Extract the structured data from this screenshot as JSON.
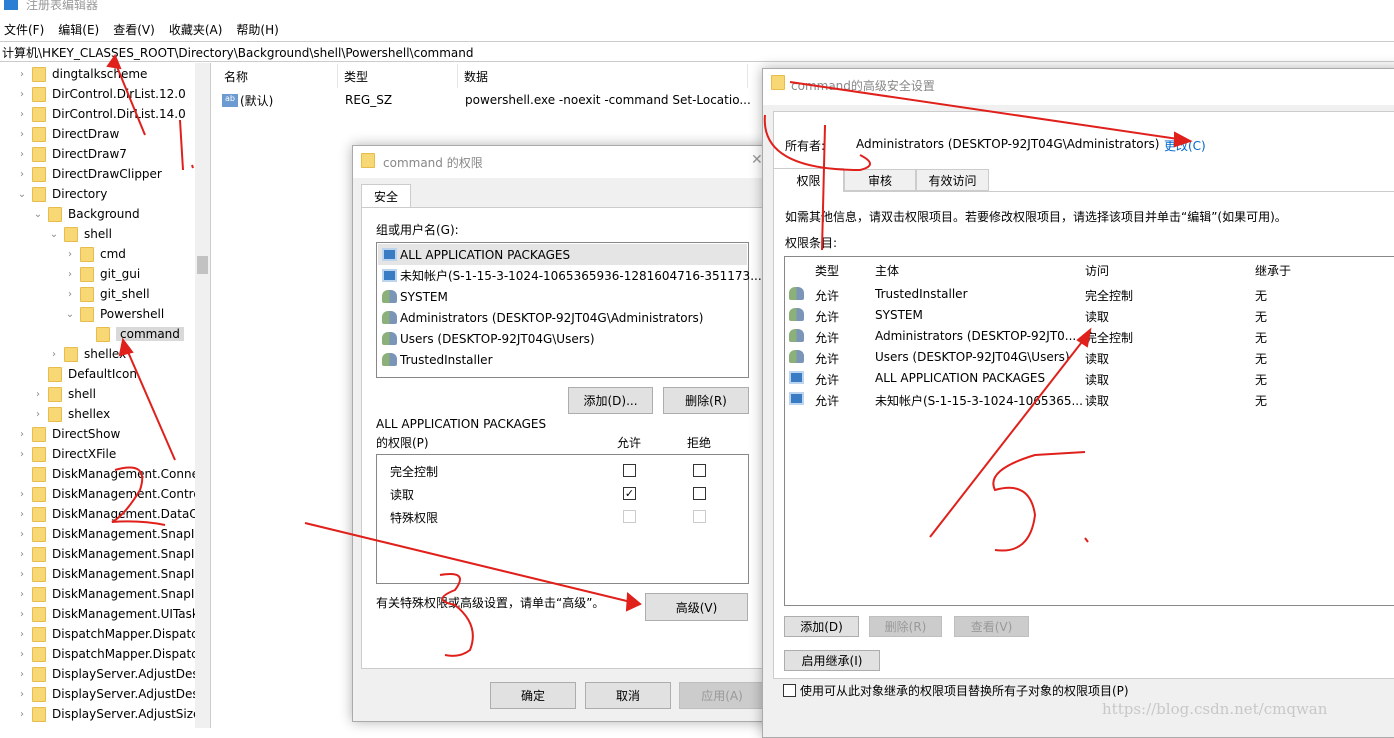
{
  "app": {
    "title": "注册表编辑器"
  },
  "menu": [
    "文件(F)",
    "编辑(E)",
    "查看(V)",
    "收藏夹(A)",
    "帮助(H)"
  ],
  "address": "计算机\\HKEY_CLASSES_ROOT\\Directory\\Background\\shell\\Powershell\\command",
  "tree": [
    {
      "label": "dingtalkscheme",
      "level": 0,
      "exp": ">"
    },
    {
      "label": "DirControl.DirList.12.0",
      "level": 0,
      "exp": ">"
    },
    {
      "label": "DirControl.DirList.14.0",
      "level": 0,
      "exp": ">"
    },
    {
      "label": "DirectDraw",
      "level": 0,
      "exp": ">"
    },
    {
      "label": "DirectDraw7",
      "level": 0,
      "exp": ">"
    },
    {
      "label": "DirectDrawClipper",
      "level": 0,
      "exp": ">"
    },
    {
      "label": "Directory",
      "level": 0,
      "exp": "v"
    },
    {
      "label": "Background",
      "level": 1,
      "exp": "v"
    },
    {
      "label": "shell",
      "level": 2,
      "exp": "v"
    },
    {
      "label": "cmd",
      "level": 3,
      "exp": ">"
    },
    {
      "label": "git_gui",
      "level": 3,
      "exp": ">"
    },
    {
      "label": "git_shell",
      "level": 3,
      "exp": ">"
    },
    {
      "label": "Powershell",
      "level": 3,
      "exp": "v"
    },
    {
      "label": "command",
      "level": 4,
      "exp": "",
      "selected": true
    },
    {
      "label": "shellex",
      "level": 2,
      "exp": ">"
    },
    {
      "label": "DefaultIcon",
      "level": 1,
      "exp": ""
    },
    {
      "label": "shell",
      "level": 1,
      "exp": ">"
    },
    {
      "label": "shellex",
      "level": 1,
      "exp": ">"
    },
    {
      "label": "DirectShow",
      "level": 0,
      "exp": ">"
    },
    {
      "label": "DirectXFile",
      "level": 0,
      "exp": ">"
    },
    {
      "label": "DiskManagement.Conne",
      "level": 0,
      "exp": ""
    },
    {
      "label": "DiskManagement.Contro",
      "level": 0,
      "exp": ">"
    },
    {
      "label": "DiskManagement.DataO",
      "level": 0,
      "exp": ">"
    },
    {
      "label": "DiskManagement.SnapIr",
      "level": 0,
      "exp": ">"
    },
    {
      "label": "DiskManagement.SnapIr",
      "level": 0,
      "exp": ">"
    },
    {
      "label": "DiskManagement.SnapIr",
      "level": 0,
      "exp": ">"
    },
    {
      "label": "DiskManagement.SnapIr",
      "level": 0,
      "exp": ">"
    },
    {
      "label": "DiskManagement.UITask",
      "level": 0,
      "exp": ">"
    },
    {
      "label": "DispatchMapper.Dispatc",
      "level": 0,
      "exp": ">"
    },
    {
      "label": "DispatchMapper.Dispatc",
      "level": 0,
      "exp": ">"
    },
    {
      "label": "DisplayServer.AdjustDesl",
      "level": 0,
      "exp": ">"
    },
    {
      "label": "DisplayServer.AdjustDesl",
      "level": 0,
      "exp": ">"
    },
    {
      "label": "DisplayServer.AdjustSizel",
      "level": 0,
      "exp": ">"
    }
  ],
  "list": {
    "headers": [
      "名称",
      "类型",
      "数据"
    ],
    "rows": [
      {
        "name": "(默认)",
        "type": "REG_SZ",
        "data": "powershell.exe -noexit -command Set-Locatio..."
      }
    ]
  },
  "perm_dialog": {
    "title": "command 的权限",
    "tab": "安全",
    "group_label": "组或用户名(G):",
    "users": [
      {
        "name": "ALL APPLICATION PACKAGES",
        "icon": "package"
      },
      {
        "name": "未知帐户(S-1-15-3-1024-1065365936-1281604716-351173...",
        "icon": "package"
      },
      {
        "name": "SYSTEM",
        "icon": "users"
      },
      {
        "name": "Administrators (DESKTOP-92JT04G\\Administrators)",
        "icon": "users"
      },
      {
        "name": "Users (DESKTOP-92JT04G\\Users)",
        "icon": "users"
      },
      {
        "name": "TrustedInstaller",
        "icon": "users"
      }
    ],
    "add": "添加(D)...",
    "remove": "删除(R)",
    "perm_for": "ALL APPLICATION PACKAGES",
    "perm_label": "的权限(P)",
    "allow": "允许",
    "deny": "拒绝",
    "perms": [
      {
        "name": "完全控制",
        "allow": false,
        "deny": false,
        "disabled": false
      },
      {
        "name": "读取",
        "allow": true,
        "deny": false,
        "disabled": false
      },
      {
        "name": "特殊权限",
        "allow": false,
        "deny": false,
        "disabled": true
      }
    ],
    "advanced_hint": "有关特殊权限或高级设置，请单击“高级”。",
    "advanced": "高级(V)",
    "ok": "确定",
    "cancel": "取消",
    "apply": "应用(A)"
  },
  "adv_dialog": {
    "title": "command的高级安全设置",
    "owner_label": "所有者:",
    "owner": "Administrators (DESKTOP-92JT04G\\Administrators)",
    "change": "更改(C)",
    "tabs": [
      "权限",
      "审核",
      "有效访问"
    ],
    "info": "如需其他信息，请双击权限项目。若要修改权限项目，请选择该项目并单击“编辑”(如果可用)。",
    "entries_label": "权限条目:",
    "headers": [
      "类型",
      "主体",
      "访问",
      "继承于"
    ],
    "rows": [
      {
        "icon": "users",
        "type": "允许",
        "principal": "TrustedInstaller",
        "access": "完全控制",
        "inherit": "无"
      },
      {
        "icon": "users",
        "type": "允许",
        "principal": "SYSTEM",
        "access": "读取",
        "inherit": "无"
      },
      {
        "icon": "users",
        "type": "允许",
        "principal": "Administrators (DESKTOP-92JT0...",
        "access": "完全控制",
        "inherit": "无"
      },
      {
        "icon": "users",
        "type": "允许",
        "principal": "Users (DESKTOP-92JT04G\\Users)",
        "access": "读取",
        "inherit": "无"
      },
      {
        "icon": "package",
        "type": "允许",
        "principal": "ALL APPLICATION PACKAGES",
        "access": "读取",
        "inherit": "无"
      },
      {
        "icon": "package",
        "type": "允许",
        "principal": "未知帐户(S-1-15-3-1024-1065365...",
        "access": "读取",
        "inherit": "无"
      }
    ],
    "add": "添加(D)",
    "remove": "删除(R)",
    "view": "查看(V)",
    "enable_inherit": "启用继承(I)",
    "replace_label": "使用可从此对象继承的权限项目替换所有子对象的权限项目(P)",
    "replace_checked": false
  },
  "watermark": "https://blog.csdn.net/cmqwan",
  "colors": {
    "annotation": "#e0201b",
    "link": "#0066cc",
    "folder": "#f8d775"
  }
}
